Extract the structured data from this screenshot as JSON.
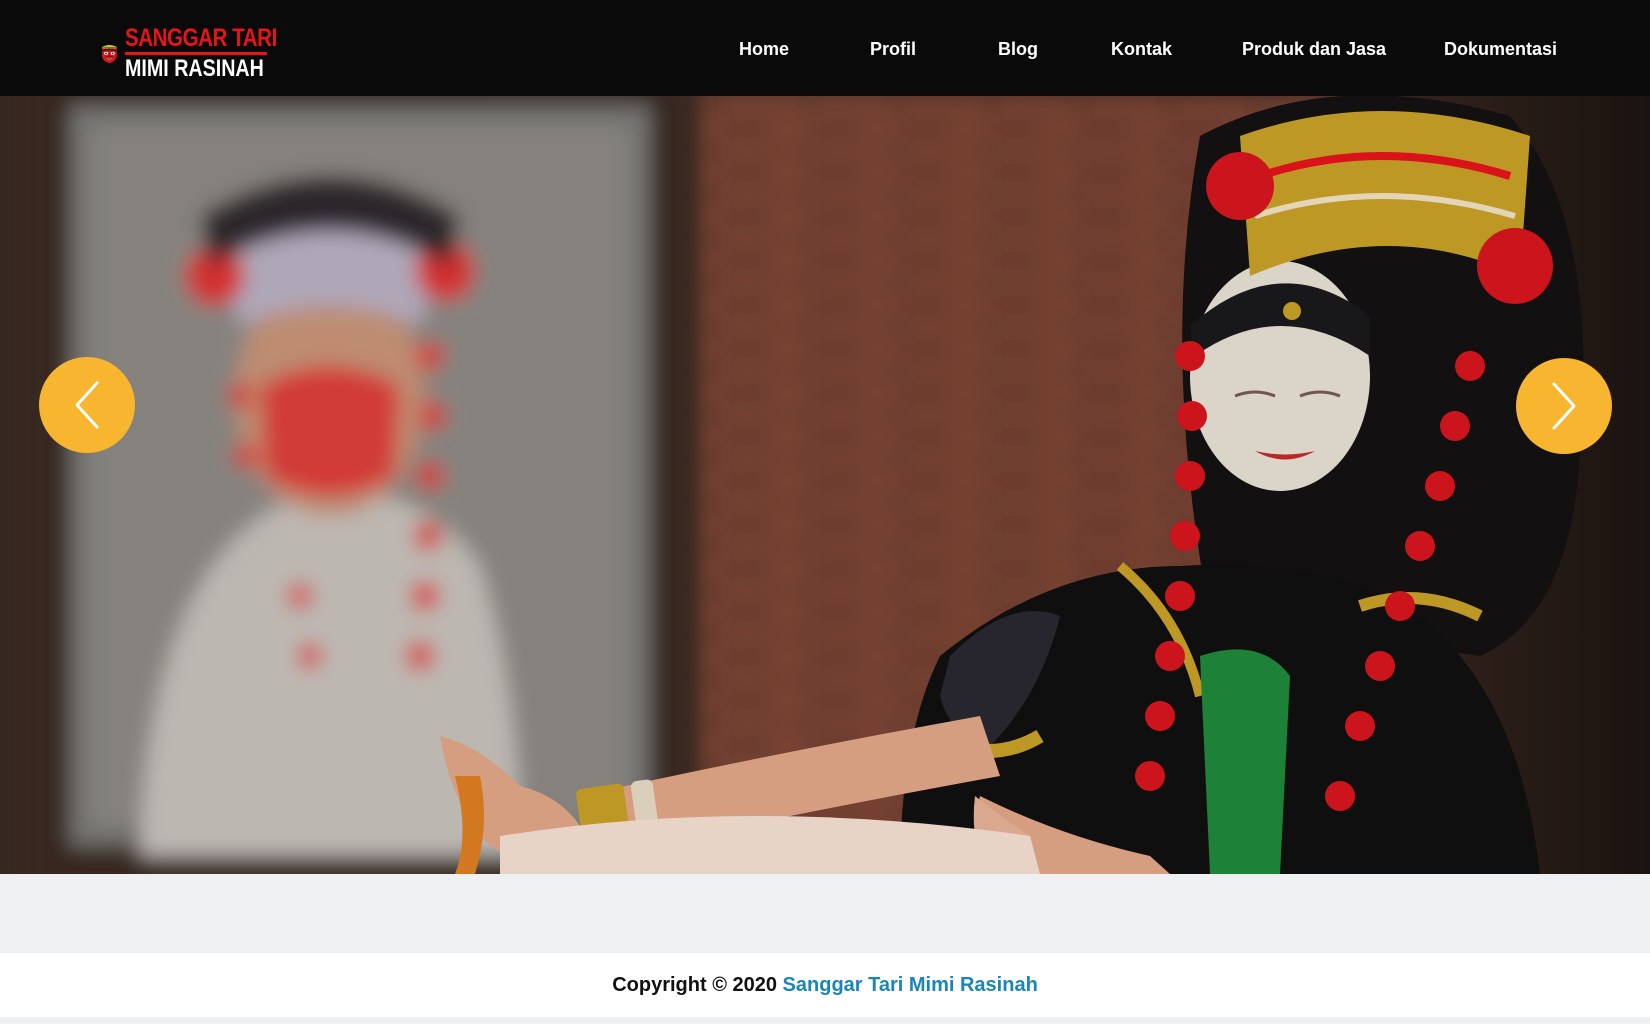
{
  "brand": {
    "line1": "SANGGAR TARI",
    "line2": "MIMI RASINAH",
    "primary_color": "#e8141b"
  },
  "nav": {
    "items": [
      {
        "label": "Home"
      },
      {
        "label": "Profil"
      },
      {
        "label": "Blog"
      },
      {
        "label": "Kontak"
      },
      {
        "label": "Produk dan Jasa"
      },
      {
        "label": "Dokumentasi"
      }
    ]
  },
  "hero": {
    "prev_icon": "chevron-left-icon",
    "next_icon": "chevron-right-icon",
    "arrow_color": "#f8b52f"
  },
  "footer": {
    "copyright_prefix": "Copyright © 2020",
    "site_name": "Sanggar Tari Mimi Rasinah",
    "link_color": "#1a86b8"
  }
}
